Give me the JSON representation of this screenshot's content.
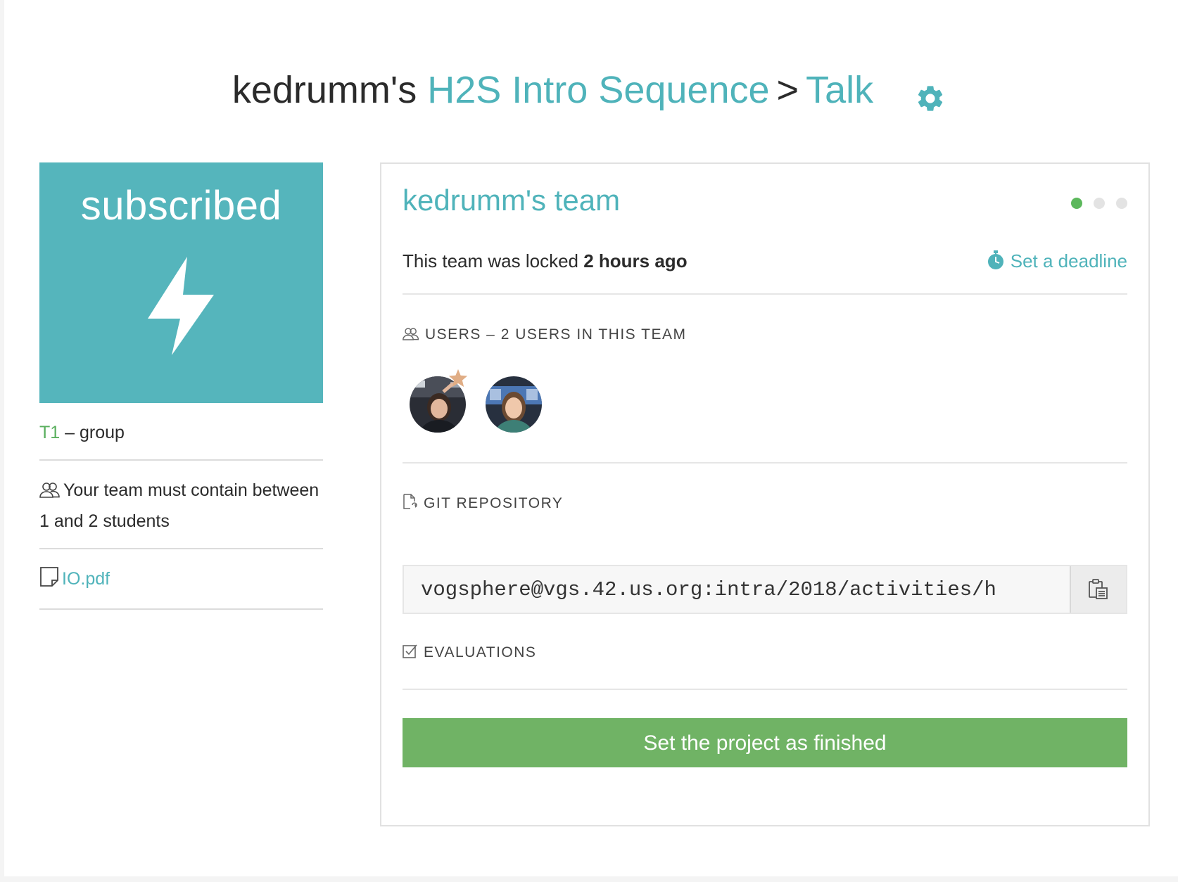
{
  "header": {
    "user_prefix": "kedrumm's",
    "project_link": "H2S Intro Sequence",
    "separator": ">",
    "activity_link": "Talk",
    "settings_icon": "gear-icon"
  },
  "left": {
    "status": "subscribed",
    "status_icon": "lightning-bolt-icon",
    "tier": "T1",
    "tier_suffix": "– group",
    "team_rule": "Your team must contain between 1 and 2 students",
    "attachment": "IO.pdf"
  },
  "team": {
    "title": "kedrumm's team",
    "locked_text": "This team was locked",
    "locked_time": "2 hours ago",
    "deadline_link": "Set a deadline",
    "progress_steps": 3,
    "progress_active": 1
  },
  "users": {
    "label": "USERS – 2 USERS IN THIS TEAM",
    "leader_marker": "star-icon"
  },
  "git": {
    "label": "GIT REPOSITORY",
    "url": "vogsphere@vgs.42.us.org:intra/2018/activities/h",
    "copy_icon": "clipboard-icon"
  },
  "evaluations": {
    "label": "EVALUATIONS"
  },
  "actions": {
    "finish_label": "Set the project as finished"
  },
  "colors": {
    "accent": "#4fb3ba",
    "badge": "#55b5bc",
    "success": "#70b365",
    "active_dot": "#5cb85c"
  }
}
